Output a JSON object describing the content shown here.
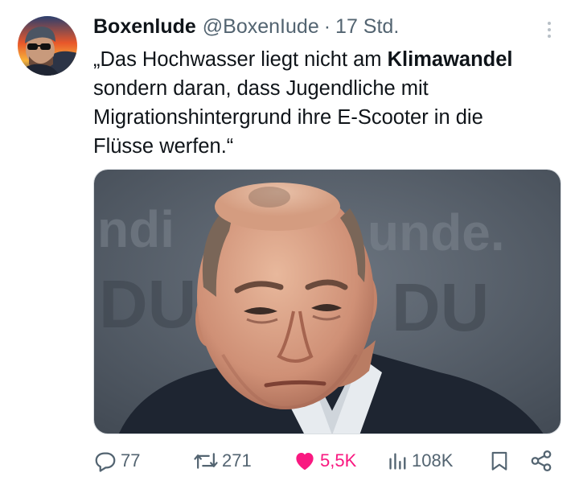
{
  "tweet": {
    "author_name": "Boxenlude",
    "handle": "@BoxenIude",
    "separator": "·",
    "time": "17 Std.",
    "text_lines": [
      "„Das Hochwasser liegt nicht am ",
      "sondern daran, dass Jugendliche mit",
      "Migrationshintergrund ihre E-Scooter in die",
      "Flüsse werfen.“"
    ],
    "text_bold": "Klimawandel",
    "media_background_text": {
      "top_left": "ndi",
      "top_right": "unde.",
      "bottom_left": "DU",
      "bottom_right": "DU"
    }
  },
  "actions": {
    "replies": "77",
    "reposts": "271",
    "likes": "5,5K",
    "views": "108K"
  },
  "colors": {
    "text": "#0f1419",
    "secondary": "#536471",
    "like_pink": "#f91880",
    "media_bg": "#545d67"
  },
  "icons": [
    "more-icon",
    "reply-icon",
    "repost-icon",
    "like-icon",
    "views-icon",
    "bookmark-icon",
    "share-icon"
  ]
}
